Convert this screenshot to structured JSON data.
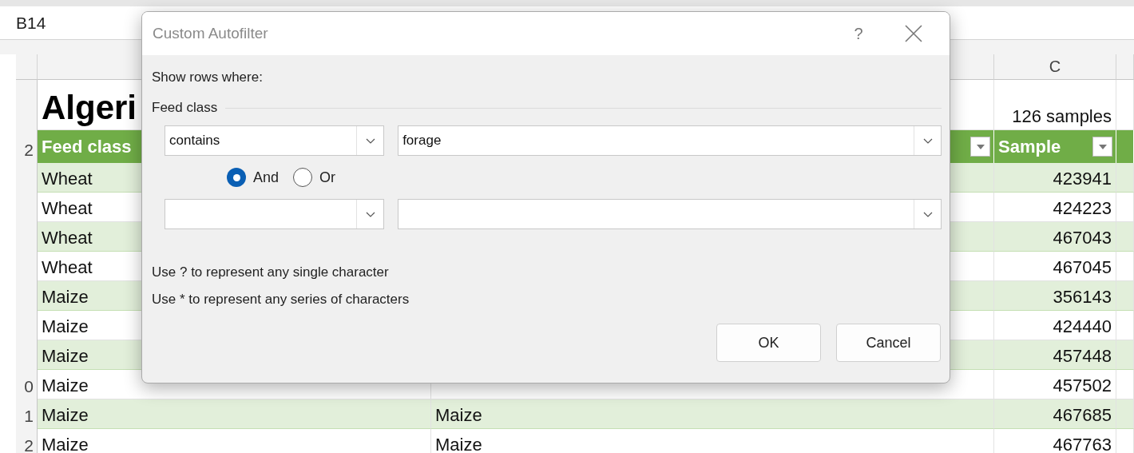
{
  "name_box": "B14",
  "column_header": "C",
  "rows": [
    {
      "kind": "title",
      "a": "Algeri",
      "c": "126 samples"
    },
    {
      "kind": "header",
      "number": "2",
      "a": "Feed class",
      "c": "Sample"
    },
    {
      "kind": "data",
      "a": "Wheat",
      "c": "423941"
    },
    {
      "kind": "data",
      "a": "Wheat",
      "c": "424223"
    },
    {
      "kind": "data",
      "a": "Wheat",
      "c": "467043"
    },
    {
      "kind": "data",
      "a": "Wheat",
      "c": "467045"
    },
    {
      "kind": "data",
      "a": "Maize",
      "c": "356143"
    },
    {
      "kind": "data",
      "a": "Maize",
      "c": "424440"
    },
    {
      "kind": "data",
      "a": "Maize",
      "c": "457448"
    },
    {
      "kind": "data",
      "number": "0",
      "a": "Maize",
      "c": "457502"
    },
    {
      "kind": "data",
      "number": "1",
      "a": "Maize",
      "b": "Maize",
      "c": "467685"
    },
    {
      "kind": "data",
      "number": "2",
      "a": "Maize",
      "b": "Maize",
      "c": "467763"
    }
  ],
  "dialog": {
    "title": "Custom Autofilter",
    "help": "?",
    "intro": "Show rows where:",
    "group": "Feed class",
    "condition_1": {
      "operator": "contains",
      "value": "forage"
    },
    "joins": [
      {
        "label": "And",
        "selected": true
      },
      {
        "label": "Or",
        "selected": false
      }
    ],
    "hints": [
      "Use ? to represent any single character",
      "Use * to represent any series of characters"
    ],
    "buttons": [
      "OK",
      "Cancel"
    ]
  }
}
